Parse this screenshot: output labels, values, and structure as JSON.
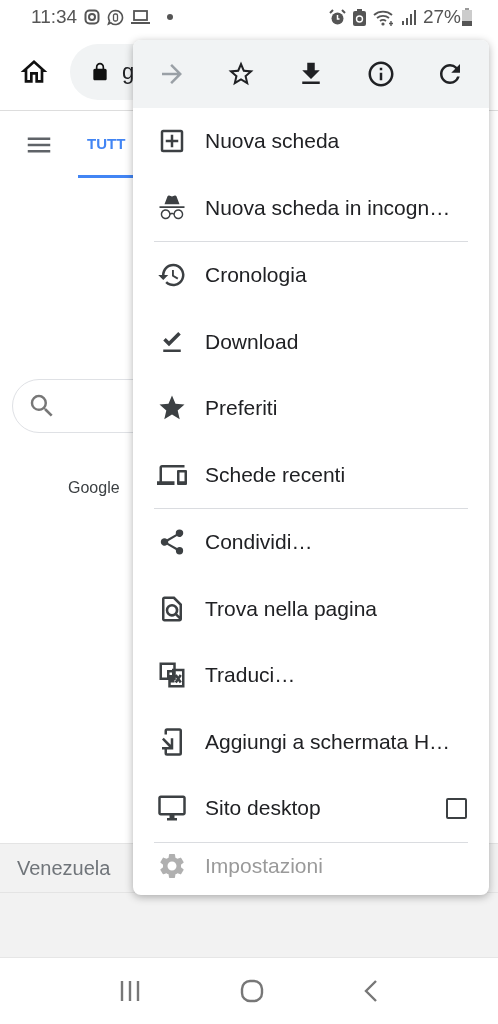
{
  "status_bar": {
    "time": "11:34",
    "battery": "27%"
  },
  "toolbar": {
    "url": "g"
  },
  "tabs": [
    {
      "label": "TUTT",
      "selected": true
    }
  ],
  "page": {
    "footer_text": "Google",
    "location": "Venezuela"
  },
  "menu": {
    "actions": [
      {
        "disabled": true
      },
      {
        "disabled": false
      },
      {
        "disabled": false
      },
      {
        "disabled": false
      },
      {
        "disabled": false
      }
    ],
    "items": [
      {
        "kind": "item",
        "label": "Nuova scheda",
        "faded": false
      },
      {
        "kind": "item",
        "label": "Nuova scheda in incogn…",
        "faded": false
      },
      {
        "kind": "divider"
      },
      {
        "kind": "item",
        "label": "Cronologia",
        "faded": false
      },
      {
        "kind": "item",
        "label": "Download",
        "faded": false
      },
      {
        "kind": "item",
        "label": "Preferiti",
        "faded": false
      },
      {
        "kind": "item",
        "label": "Schede recenti",
        "faded": false
      },
      {
        "kind": "divider"
      },
      {
        "kind": "item",
        "label": "Condividi…",
        "faded": false
      },
      {
        "kind": "item",
        "label": "Trova nella pagina",
        "faded": false
      },
      {
        "kind": "item",
        "label": "Traduci…",
        "faded": false
      },
      {
        "kind": "item",
        "label": "Aggiungi a schermata H…",
        "faded": false
      },
      {
        "kind": "checkbox",
        "label": "Sito desktop",
        "checked": false,
        "faded": false
      },
      {
        "kind": "divider"
      },
      {
        "kind": "item",
        "label": "Impostazioni",
        "faded": true
      }
    ]
  }
}
